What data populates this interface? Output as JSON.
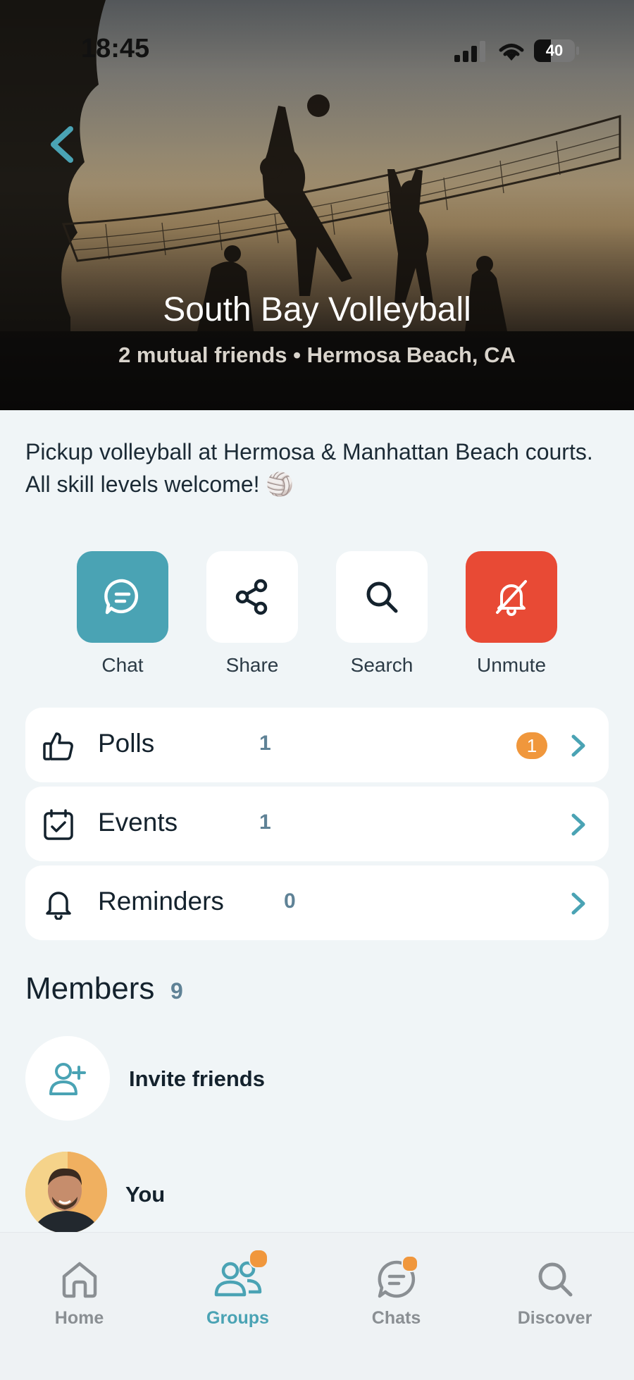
{
  "status_bar": {
    "time": "18:45",
    "battery": "40"
  },
  "group": {
    "name": "South Bay Volleyball",
    "subtitle": "2 mutual friends • Hermosa Beach, CA",
    "description": "Pickup volleyball at Hermosa & Manhattan Beach courts. All skill levels welcome! 🏐"
  },
  "actions": [
    {
      "label": "Chat",
      "icon": "chat-bubble-icon"
    },
    {
      "label": "Share",
      "icon": "share-icon"
    },
    {
      "label": "Search",
      "icon": "search-icon"
    },
    {
      "label": "Unmute",
      "icon": "bell-off-icon"
    }
  ],
  "rows": [
    {
      "label": "Polls",
      "count": "1",
      "badge": "1",
      "icon": "thumbs-up-icon"
    },
    {
      "label": "Events",
      "count": "1",
      "icon": "calendar-check-icon"
    },
    {
      "label": "Reminders",
      "count": "0",
      "icon": "bell-icon"
    }
  ],
  "members": {
    "title": "Members",
    "count": "9",
    "invite_label": "Invite friends",
    "list": [
      {
        "name": "You"
      }
    ]
  },
  "tabs": [
    {
      "label": "Home",
      "icon": "home-icon"
    },
    {
      "label": "Groups",
      "icon": "groups-icon",
      "active": true
    },
    {
      "label": "Chats",
      "icon": "chats-icon"
    },
    {
      "label": "Discover",
      "icon": "discover-icon"
    }
  ],
  "colors": {
    "accent": "#4aa3b4",
    "chat_button": "#4aa3b4",
    "unmute_button": "#e84a35",
    "badge": "#f0973c"
  }
}
